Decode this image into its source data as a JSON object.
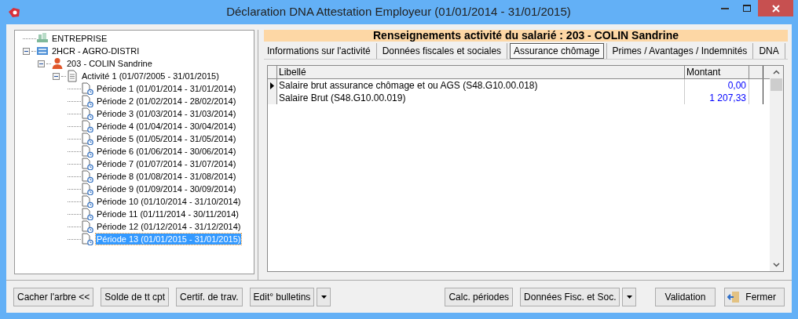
{
  "window": {
    "title": "Déclaration DNA Attestation Employeur  (01/01/2014 - 31/01/2015)"
  },
  "tree": [
    {
      "label": "ENTREPRISE",
      "kind": "company",
      "selected": false
    },
    {
      "label": "2HCR - AGRO-DISTRI",
      "kind": "establishment",
      "expanded": true,
      "selected": false,
      "children": [
        {
          "label": "203 - COLIN Sandrine",
          "kind": "person",
          "expanded": true,
          "selected": false,
          "children": [
            {
              "label": "Activité 1 (01/07/2005 - 31/01/2015)",
              "kind": "activity",
              "expanded": true,
              "selected": false,
              "children": [
                {
                  "label": "Période 1 (01/01/2014 - 31/01/2014)",
                  "kind": "period",
                  "selected": false
                },
                {
                  "label": "Période 2 (01/02/2014 - 28/02/2014)",
                  "kind": "period",
                  "selected": false
                },
                {
                  "label": "Période 3 (01/03/2014 - 31/03/2014)",
                  "kind": "period",
                  "selected": false
                },
                {
                  "label": "Période 4 (01/04/2014 - 30/04/2014)",
                  "kind": "period",
                  "selected": false
                },
                {
                  "label": "Période 5 (01/05/2014 - 31/05/2014)",
                  "kind": "period",
                  "selected": false
                },
                {
                  "label": "Période 6 (01/06/2014 - 30/06/2014)",
                  "kind": "period",
                  "selected": false
                },
                {
                  "label": "Période 7 (01/07/2014 - 31/07/2014)",
                  "kind": "period",
                  "selected": false
                },
                {
                  "label": "Période 8 (01/08/2014 - 31/08/2014)",
                  "kind": "period",
                  "selected": false
                },
                {
                  "label": "Période 9 (01/09/2014 - 30/09/2014)",
                  "kind": "period",
                  "selected": false
                },
                {
                  "label": "Période 10 (01/10/2014 - 31/10/2014)",
                  "kind": "period",
                  "selected": false
                },
                {
                  "label": "Période 11 (01/11/2014 - 30/11/2014)",
                  "kind": "period",
                  "selected": false
                },
                {
                  "label": "Période 12 (01/12/2014 - 31/12/2014)",
                  "kind": "period",
                  "selected": false
                },
                {
                  "label": "Période 13 (01/01/2015 - 31/01/2015)",
                  "kind": "period",
                  "selected": true
                }
              ]
            }
          ]
        }
      ]
    }
  ],
  "panel": {
    "header": "Renseignements activité du salarié : 203 - COLIN Sandrine",
    "tabs": [
      {
        "label": "Informations sur l'activité",
        "selected": false
      },
      {
        "label": "Données fiscales et sociales",
        "selected": false
      },
      {
        "label": "Assurance chômage",
        "selected": true
      },
      {
        "label": "Primes / Avantages / Indemnités",
        "selected": false
      },
      {
        "label": "DNA",
        "selected": false
      }
    ],
    "table": {
      "columns": [
        "Libellé",
        "Montant"
      ],
      "rows": [
        {
          "libelle": "Salaire brut assurance chômage et ou AGS (S48.G10.00.018)",
          "montant": "0,00",
          "selected": true
        },
        {
          "libelle": "Salaire Brut (S48.G10.00.019)",
          "montant": "1 207,33",
          "selected": false
        }
      ]
    }
  },
  "buttons_left": [
    {
      "label": "Cacher l'arbre <<",
      "kind": "button"
    },
    {
      "label": "Solde de tt cpt",
      "kind": "button"
    },
    {
      "label": "Certif. de trav.",
      "kind": "button"
    },
    {
      "label": "Edit° bulletins",
      "kind": "button"
    },
    {
      "kind": "dropdown"
    }
  ],
  "buttons_middle": [
    {
      "label": "Calc. périodes",
      "kind": "button"
    },
    {
      "label": "Données Fisc. et Soc.",
      "kind": "button"
    },
    {
      "kind": "dropdown"
    }
  ],
  "buttons_right": [
    {
      "label": "Validation",
      "kind": "button"
    },
    {
      "label": "Fermer",
      "kind": "exit"
    }
  ]
}
